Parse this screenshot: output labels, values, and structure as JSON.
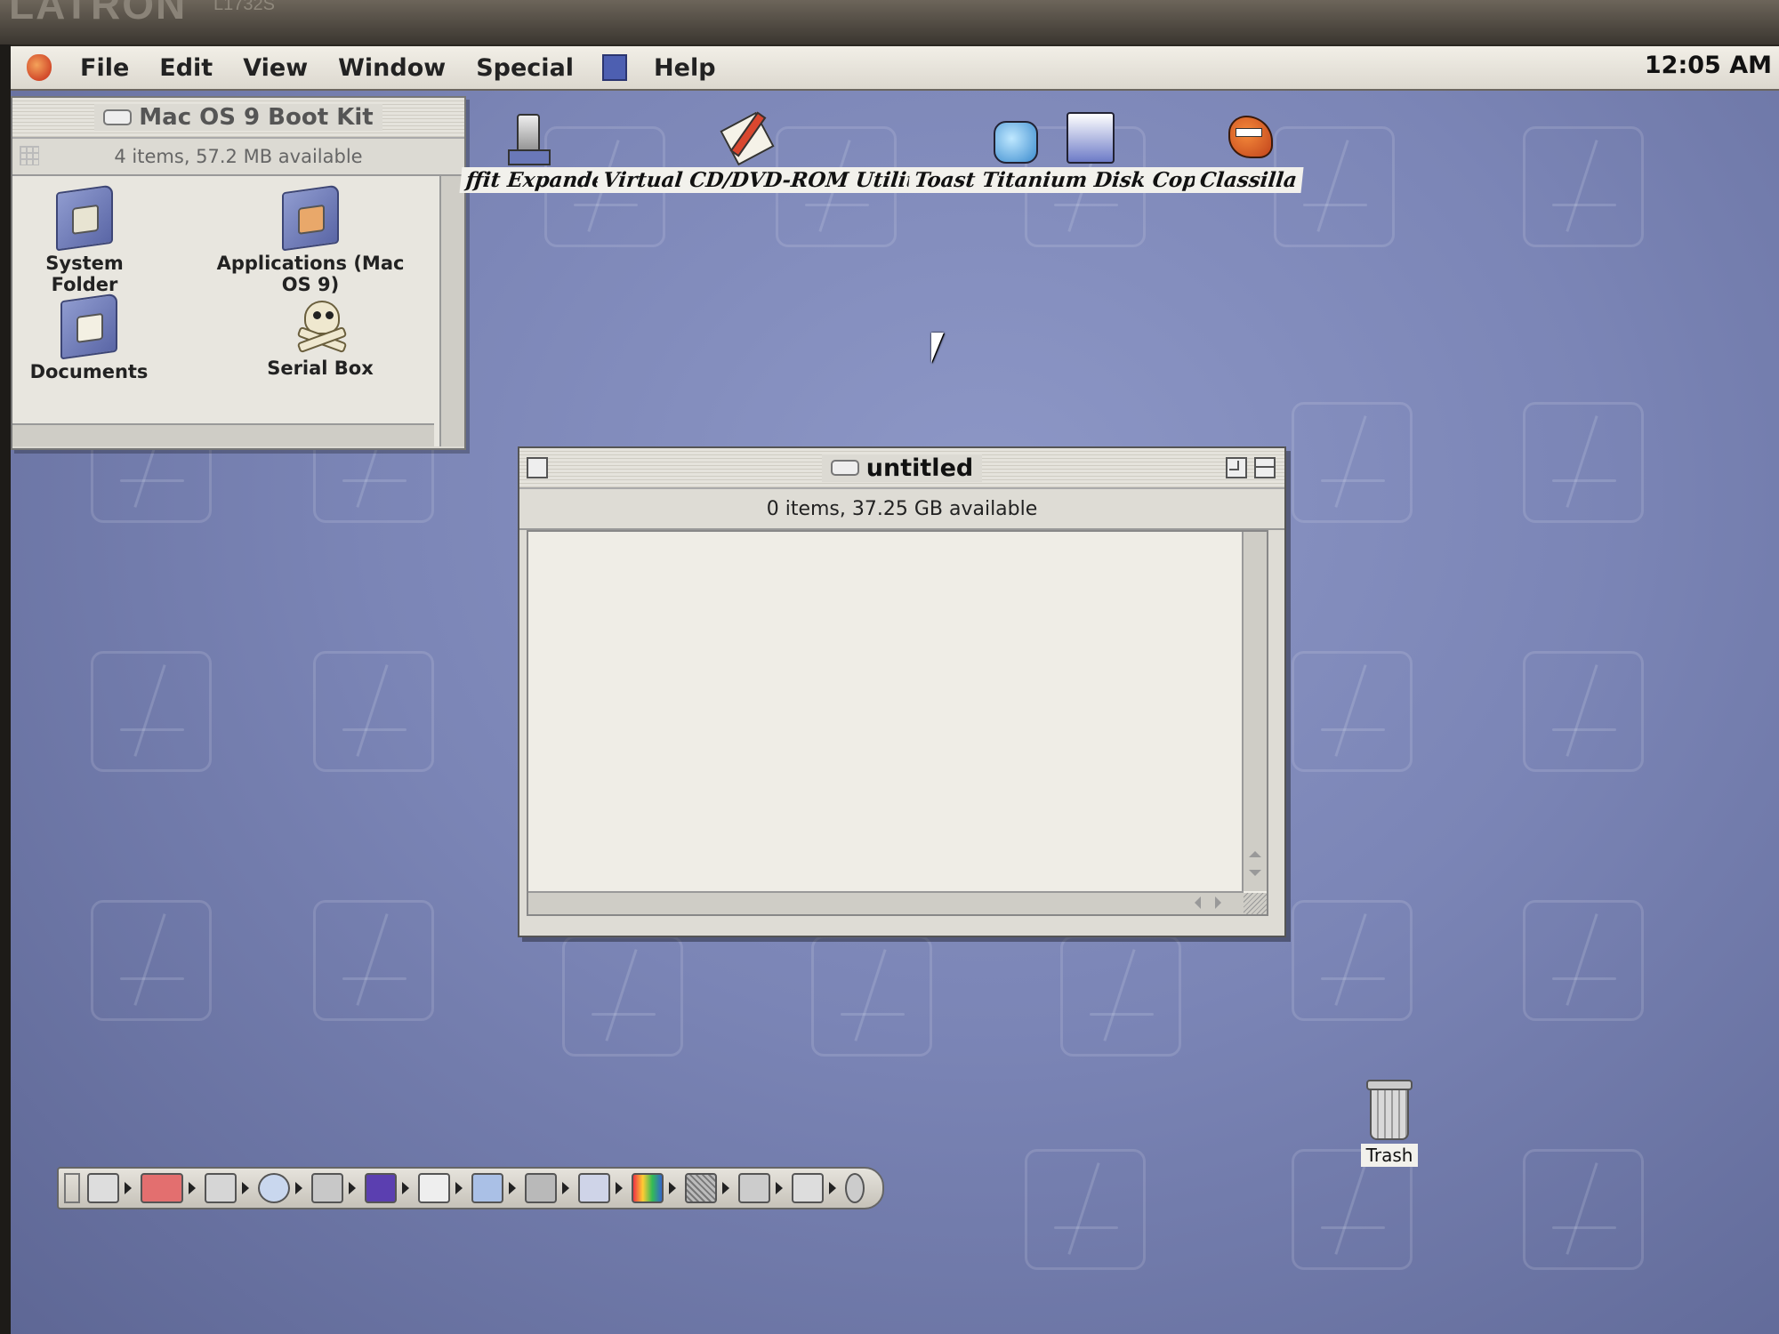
{
  "monitor": {
    "brand": "LATRON",
    "model": "L1732S"
  },
  "menubar": {
    "items": [
      "File",
      "Edit",
      "View",
      "Window",
      "Special",
      "Help"
    ],
    "clock": "12:05 AM"
  },
  "boot_kit_window": {
    "title": "Mac OS 9 Boot Kit",
    "info": "4 items, 57.2 MB available",
    "items": [
      {
        "label": "System Folder",
        "icon": "system-folder-icon"
      },
      {
        "label": "Applications (Mac OS 9)",
        "icon": "applications-folder-icon"
      },
      {
        "label": "Documents",
        "icon": "documents-folder-icon"
      },
      {
        "label": "Serial Box",
        "icon": "skull-icon"
      }
    ]
  },
  "desktop_icons": [
    {
      "label": "Stuffit Expander",
      "visible_label": "ffit Expander",
      "icon": "stuffit-icon"
    },
    {
      "label": "Virtual CD/DVD-ROM Utility",
      "icon": "pencil-document-icon"
    },
    {
      "label": "Toast Titanium Disk Copy",
      "icon": "toast-icon"
    },
    {
      "label": "Classilla",
      "icon": "classilla-dragon-icon"
    }
  ],
  "untitled_window": {
    "title": "untitled",
    "info": "0 items, 37.25 GB available"
  },
  "trash": {
    "label": "Trash"
  },
  "colors": {
    "desktop": "#7b85b6",
    "menubar": "#e8e5dd",
    "window": "#dcdad3"
  }
}
